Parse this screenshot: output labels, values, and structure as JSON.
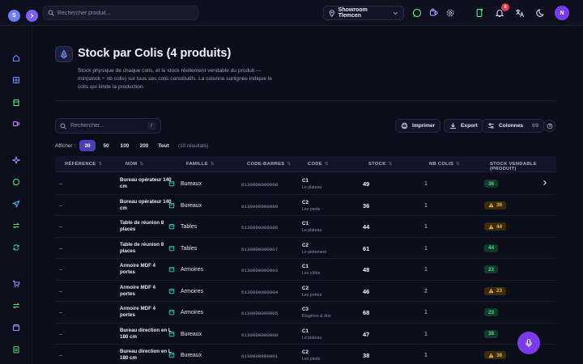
{
  "topbar": {
    "logo_letter": "S",
    "search_placeholder": "Rechercher produit...",
    "showroom": "Showroom Tlemcen",
    "notifications_count": "8",
    "avatar_letter": "N"
  },
  "page": {
    "title": "Stock par Colis (4 produits)",
    "description": "Stock physique de chaque colis, et le stock réellement vendable du produit — min(stock ÷ nb colis) sur tous ses colis constitutifs. La colonne surlignée indique le colis qui limite la production."
  },
  "toolbar": {
    "search_placeholder": "Rechercher...",
    "search_shortcut": "/",
    "print_label": "Imprimer",
    "export_label": "Export",
    "columns_label": "Colonnes",
    "columns_count": "8/8"
  },
  "pagination": {
    "label": "Afficher :",
    "options": [
      "20",
      "50",
      "100",
      "200",
      "Tout"
    ],
    "active": "20",
    "results": "(10 résultats)"
  },
  "table": {
    "headers": [
      "RÉFÉRENCE",
      "NOM",
      "FAMILLE",
      "CODE-BARRES",
      "CODE",
      "STOCK",
      "NB COLIS",
      "STOCK VENDABLE (PRODUIT)"
    ],
    "rows": [
      {
        "ref": "–",
        "nom": "Bureau opérateur 140 cm",
        "famille": "Bureaux",
        "barcode": "6130000000008",
        "code": "C1",
        "code_sub": "Le plateau",
        "stock": "49",
        "nb_colis": "1",
        "vendable": "36",
        "status": "green"
      },
      {
        "ref": "–",
        "nom": "Bureau opérateur 140 cm",
        "famille": "Bureaux",
        "barcode": "6130000000009",
        "code": "C2",
        "code_sub": "Les pieds",
        "stock": "36",
        "nb_colis": "1",
        "vendable": "36",
        "status": "amber"
      },
      {
        "ref": "–",
        "nom": "Table de réunion 8 places",
        "famille": "Tables",
        "barcode": "6130000000006",
        "code": "C1",
        "code_sub": "Le plateau",
        "stock": "44",
        "nb_colis": "1",
        "vendable": "44",
        "status": "amber"
      },
      {
        "ref": "–",
        "nom": "Table de réunion 8 places",
        "famille": "Tables",
        "barcode": "6130000000007",
        "code": "C2",
        "code_sub": "Le piètement",
        "stock": "61",
        "nb_colis": "1",
        "vendable": "44",
        "status": "green"
      },
      {
        "ref": "–",
        "nom": "Armoire MDF 4 portes",
        "famille": "Armoires",
        "barcode": "6130000000003",
        "code": "C1",
        "code_sub": "Les côtés",
        "stock": "48",
        "nb_colis": "1",
        "vendable": "23",
        "status": "green"
      },
      {
        "ref": "–",
        "nom": "Armoire MDF 4 portes",
        "famille": "Armoires",
        "barcode": "6130000000004",
        "code": "C2",
        "code_sub": "Les portes",
        "stock": "46",
        "nb_colis": "2",
        "vendable": "23",
        "status": "amber"
      },
      {
        "ref": "–",
        "nom": "Armoire MDF 4 portes",
        "famille": "Armoires",
        "barcode": "6130000000005",
        "code": "C3",
        "code_sub": "Étagères & dos",
        "stock": "68",
        "nb_colis": "1",
        "vendable": "23",
        "status": "green"
      },
      {
        "ref": "–",
        "nom": "Bureau direction en L 180 cm",
        "famille": "Bureaux",
        "barcode": "6130000000000",
        "code": "C1",
        "code_sub": "Le plateau",
        "stock": "47",
        "nb_colis": "1",
        "vendable": "38",
        "status": "green"
      },
      {
        "ref": "–",
        "nom": "Bureau direction en L 180 cm",
        "famille": "Bureaux",
        "barcode": "6130000000001",
        "code": "C2",
        "code_sub": "Les pieds",
        "stock": "38",
        "nb_colis": "1",
        "vendable": "38",
        "status": "amber"
      }
    ]
  },
  "colors": {
    "background": "#0b0d1a",
    "accent": "#7c3aed",
    "ok": "#4ade80",
    "warn": "#f5b82e"
  },
  "icons": {
    "sidebar": [
      "home-icon",
      "grid-icon",
      "store-icon",
      "puzzle-icon",
      "sparkle-icon",
      "chat-icon",
      "send-icon",
      "transfer-icon",
      "refresh-icon",
      "cart-icon",
      "exchange-icon",
      "box-icon",
      "clipboard-icon"
    ]
  }
}
